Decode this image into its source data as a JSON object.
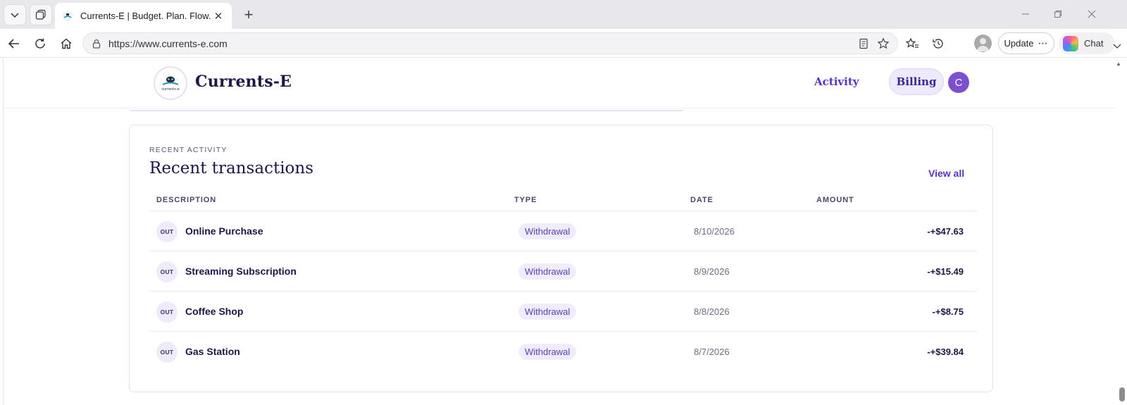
{
  "browser": {
    "tab_title": "Currents-E | Budget. Plan. Flow.",
    "url": "https://www.currents-e.com",
    "update_label": "Update",
    "chat_label": "Chat"
  },
  "header": {
    "brand": "Currents-E",
    "logo_text": "currents-e",
    "nav": [
      {
        "label": "Activity"
      },
      {
        "label": "Billing"
      }
    ],
    "user_initial": "C"
  },
  "card": {
    "eyebrow": "RECENT ACTIVITY",
    "title": "Recent transactions",
    "view_all": "View all",
    "columns": [
      "DESCRIPTION",
      "TYPE",
      "DATE",
      "AMOUNT"
    ],
    "rows": [
      {
        "badge": "OUT",
        "description": "Online Purchase",
        "type": "Withdrawal",
        "date": "8/10/2026",
        "amount": "-+$47.63"
      },
      {
        "badge": "OUT",
        "description": "Streaming Subscription",
        "type": "Withdrawal",
        "date": "8/9/2026",
        "amount": "-+$15.49"
      },
      {
        "badge": "OUT",
        "description": "Coffee Shop",
        "type": "Withdrawal",
        "date": "8/8/2026",
        "amount": "-+$8.75"
      },
      {
        "badge": "OUT",
        "description": "Gas Station",
        "type": "Withdrawal",
        "date": "8/7/2026",
        "amount": "-+$39.84"
      }
    ]
  },
  "colors": {
    "accent": "#5b2fc9",
    "brand_text": "#1d1646",
    "avatar": "#7a4fd0"
  }
}
